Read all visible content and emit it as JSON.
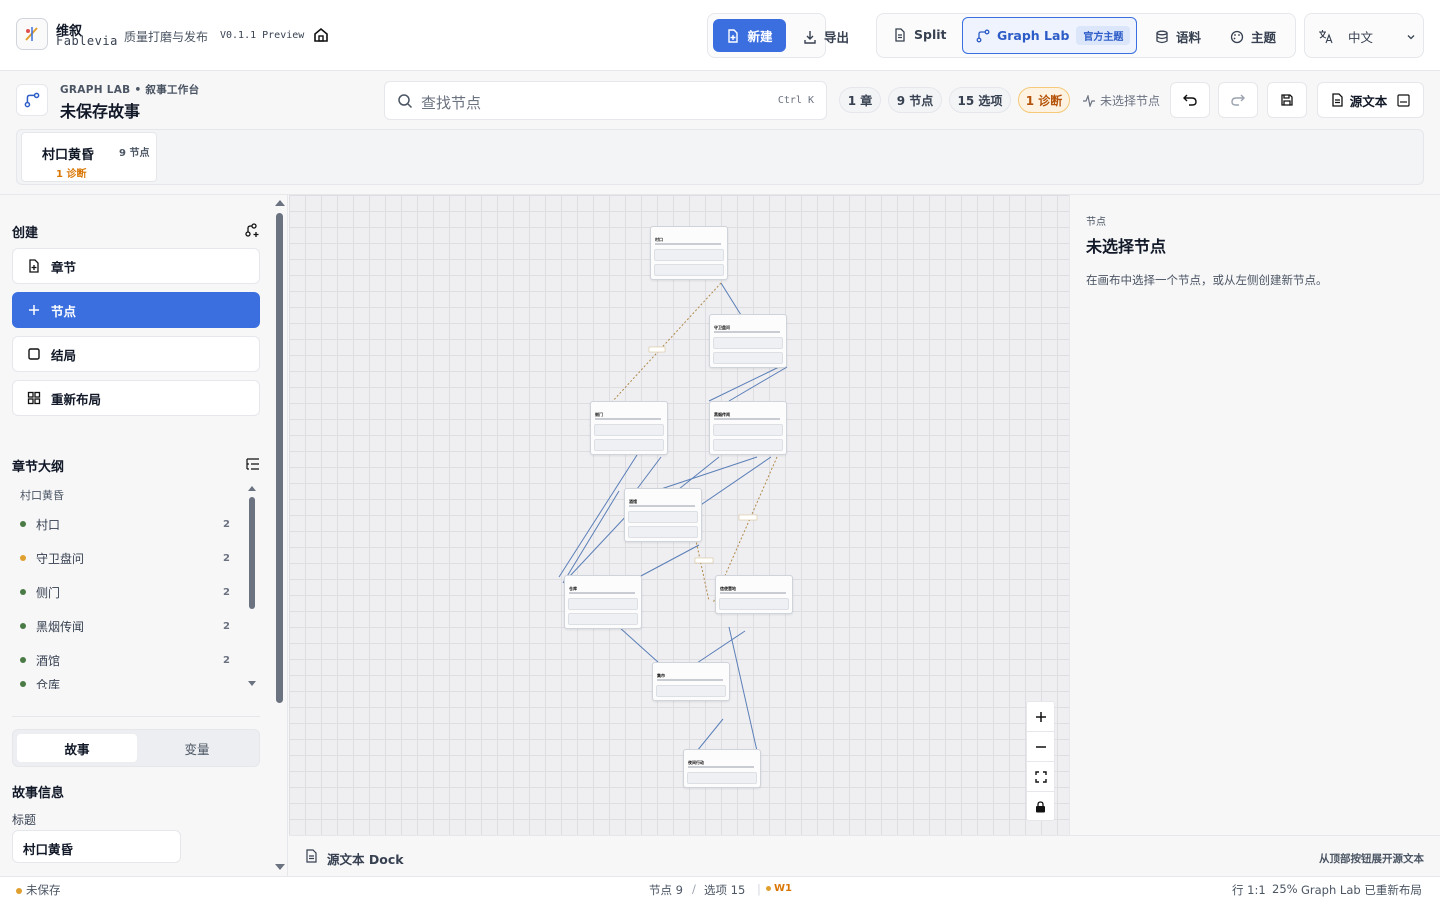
{
  "app": {
    "brand_cn": "维叙",
    "brand_en": "Fablevia",
    "subtitle": "质量打磨与发布",
    "version": "V0.1.1 Preview"
  },
  "toolbar": {
    "new_label": "新建",
    "export_label": "导出",
    "split_label": "Split",
    "graphlab_label": "Graph Lab",
    "graphlab_badge": "官方主题",
    "corpus_label": "语料",
    "theme_label": "主题",
    "lang_label": "中文"
  },
  "workspace": {
    "label": "GRAPH LAB • 叙事工作台",
    "title": "未保存故事"
  },
  "search": {
    "placeholder": "查找节点",
    "shortcut": "Ctrl K"
  },
  "stats": {
    "chapters": "1 章",
    "nodes": "9 节点",
    "options": "15 选项",
    "diagnostics": "1 诊断",
    "no_selection": "未选择节点"
  },
  "source_button": "源文本",
  "chapter_card": {
    "title": "村口黄昏",
    "count": "9 节点",
    "diag": "1 诊断"
  },
  "left": {
    "create_title": "创建",
    "buttons": {
      "chapter": "章节",
      "node": "节点",
      "ending": "结局",
      "relayout": "重新布局"
    },
    "outline_title": "章节大纲",
    "outline_chapter": "村口黄昏",
    "outline_items": [
      {
        "label": "村口",
        "count": "2",
        "color": "#4a7a45"
      },
      {
        "label": "守卫盘问",
        "count": "2",
        "color": "#e0a030"
      },
      {
        "label": "侧门",
        "count": "2",
        "color": "#4a7a45"
      },
      {
        "label": "黑烟传闻",
        "count": "2",
        "color": "#4a7a45"
      },
      {
        "label": "酒馆",
        "count": "2",
        "color": "#4a7a45"
      }
    ],
    "tabs": {
      "story": "故事",
      "variables": "变量"
    },
    "info_title": "故事信息",
    "field_label": "标题",
    "field_value": "村口黄昏"
  },
  "canvas": {
    "node_titles": [
      "村口",
      "守卫盘问",
      "侧门",
      "黑烟传闻",
      "酒馆",
      "仓库",
      "信使营地",
      "集市",
      "夜间行动"
    ]
  },
  "right": {
    "label": "节点",
    "title": "未选择节点",
    "desc": "在画布中选择一个节点，或从左侧创建新节点。"
  },
  "dock": {
    "label": "源文本 Dock",
    "hint": "从顶部按钮展开源文本"
  },
  "status": {
    "unsaved": "未保存",
    "nodes": "节点 9",
    "options": "选项 15",
    "warnings": "W1",
    "position": "行 1:1",
    "zoom": "25%",
    "layout": "Graph Lab 已重新布局"
  },
  "colors": {
    "accent": "#3b6fe0",
    "warning": "#e0a030",
    "edge": "#5b7fb8"
  }
}
